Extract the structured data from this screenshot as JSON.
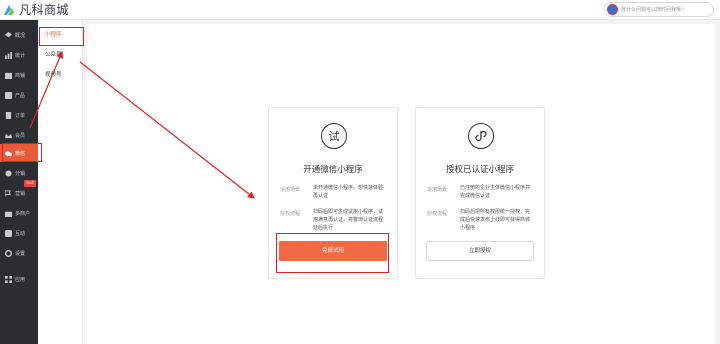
{
  "header": {
    "logo_text": "凡科商城",
    "search_text": "有什么问题可以随时问我哦~"
  },
  "sidebar": {
    "items": [
      {
        "label": "概况",
        "icon": "dashboard-icon"
      },
      {
        "label": "统计",
        "icon": "stats-icon"
      },
      {
        "label": "商铺",
        "icon": "store-icon"
      },
      {
        "label": "产品",
        "icon": "product-icon"
      },
      {
        "label": "订单",
        "icon": "order-icon"
      },
      {
        "label": "会员",
        "icon": "member-icon"
      },
      {
        "label": "微信",
        "icon": "wechat-icon"
      },
      {
        "label": "分销",
        "icon": "distribution-icon"
      },
      {
        "label": "营销",
        "icon": "marketing-icon"
      },
      {
        "label": "多商户",
        "icon": "multi-merchant-icon"
      },
      {
        "label": "互动",
        "icon": "interaction-icon"
      },
      {
        "label": "设置",
        "icon": "settings-icon"
      },
      {
        "label": "应用",
        "icon": "apps-icon"
      }
    ],
    "hot_badge": "hot"
  },
  "subnav": {
    "items": [
      "小程序",
      "公众号",
      "视频号"
    ]
  },
  "cards": [
    {
      "icon_char": "试",
      "title": "开通微信小程序",
      "scene_label": "适用场景",
      "scene_text": "未开通微信小程序，想快速体验再认证",
      "flow_label": "授权流程",
      "flow_text": "扫码后即可生成试用小程序，试用满意再认证，将繁琐认证流程延后执行",
      "button": "免费试用"
    },
    {
      "icon_char": "",
      "title": "授权已认证小程序",
      "scene_label": "适用场景",
      "scene_text": "已注册的企业主体微信小程序并完成微信认证",
      "flow_label": "授权流程",
      "flow_text": "扫码后把所有权限统一授权，完成后快速发布上线即可获得商城小程序",
      "button": "立即授权"
    }
  ],
  "colors": {
    "accent": "#f26a45",
    "sidebar_bg": "#2b2d33",
    "annotation_red": "#e02020"
  }
}
